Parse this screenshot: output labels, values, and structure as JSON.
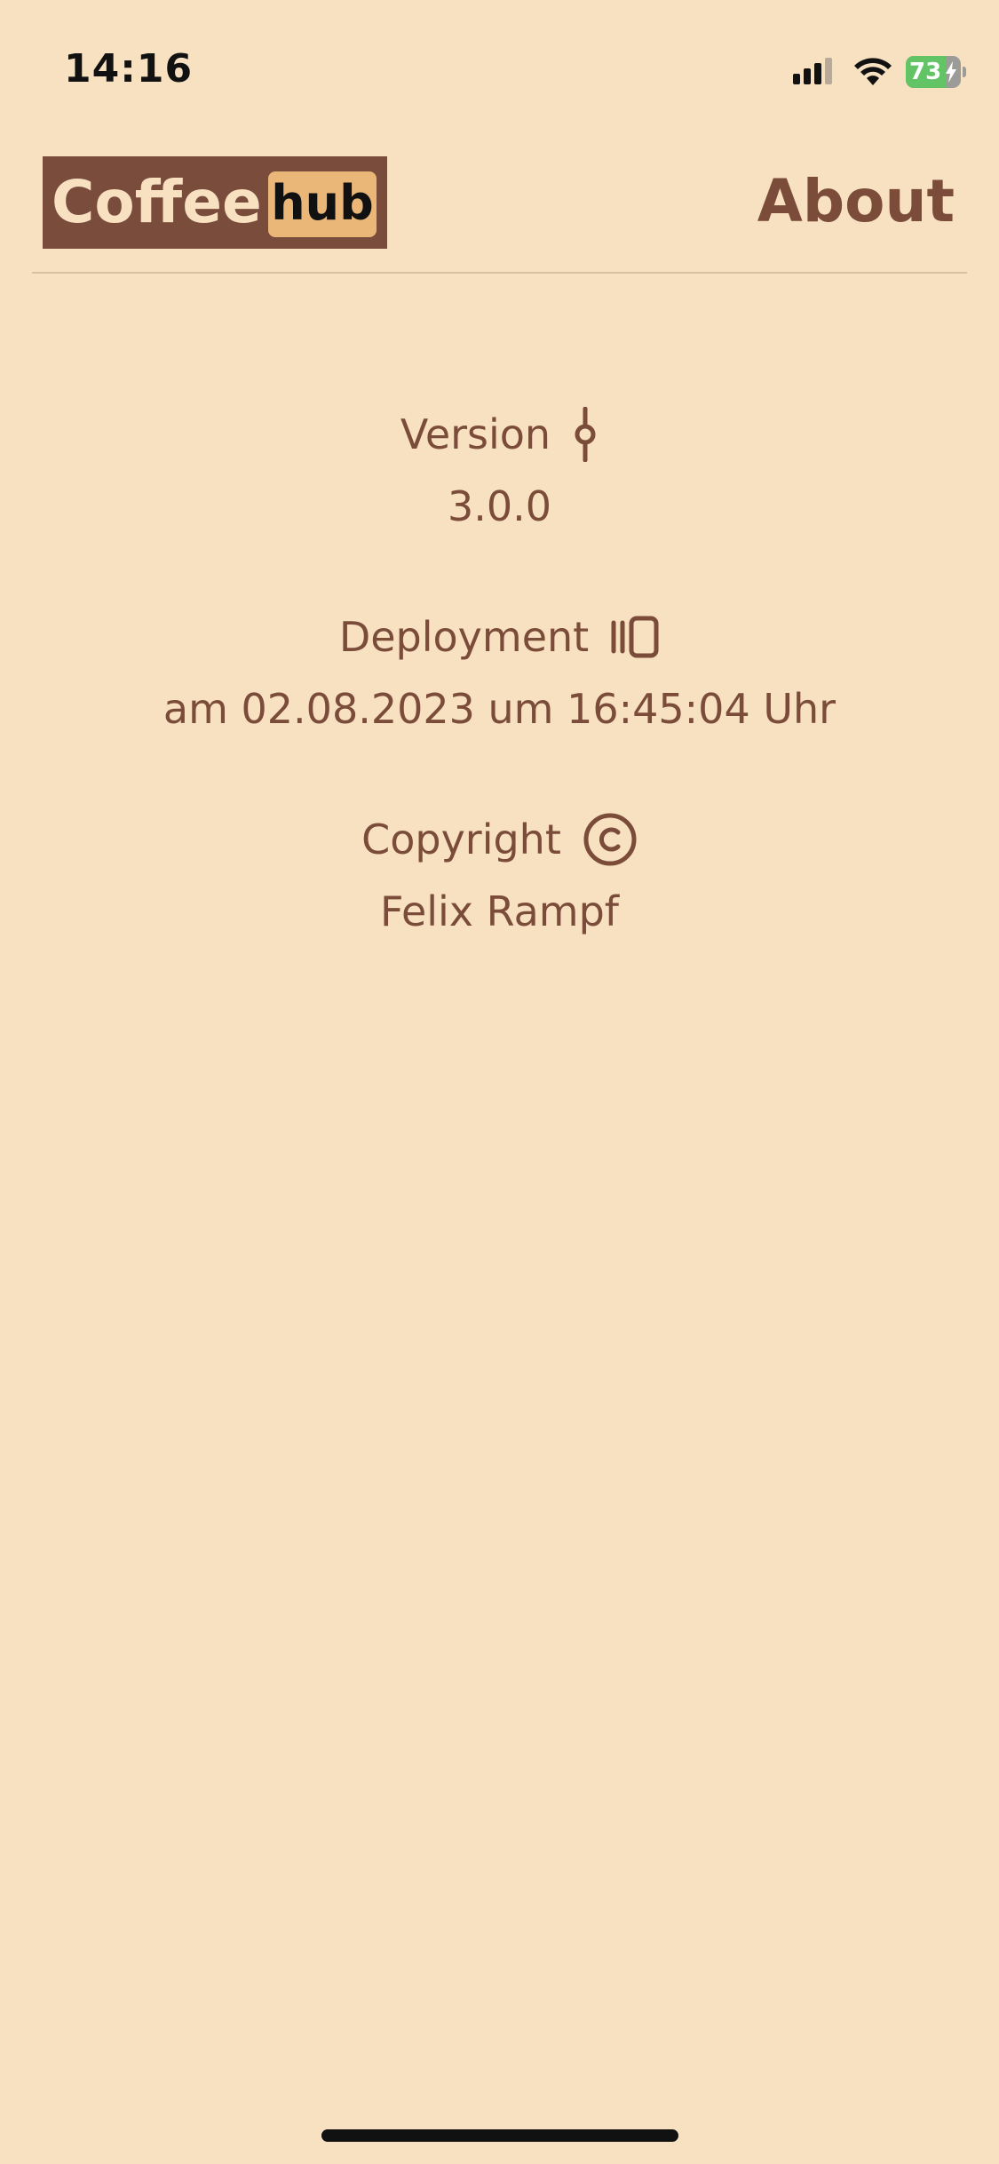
{
  "status_bar": {
    "time": "14:16",
    "battery_percent": "73",
    "battery_level": 0.73,
    "icons": [
      "cellular-signal-icon",
      "wifi-icon",
      "battery-charging-icon"
    ]
  },
  "header": {
    "logo_part1": "Coffee",
    "logo_part2": "hub",
    "title": "About"
  },
  "sections": [
    {
      "label": "Version",
      "icon": "git-commit-icon",
      "value": "3.0.0"
    },
    {
      "label": "Deployment",
      "icon": "deployment-icon",
      "value": "am 02.08.2023 um 16:45:04 Uhr"
    },
    {
      "label": "Copyright",
      "icon": "copyright-icon",
      "value": "Felix Rampf"
    }
  ],
  "colors": {
    "background": "#f7e1c1",
    "primary": "#7a4c39",
    "logo_accent": "#ebb778",
    "battery_green": "#63c466"
  }
}
